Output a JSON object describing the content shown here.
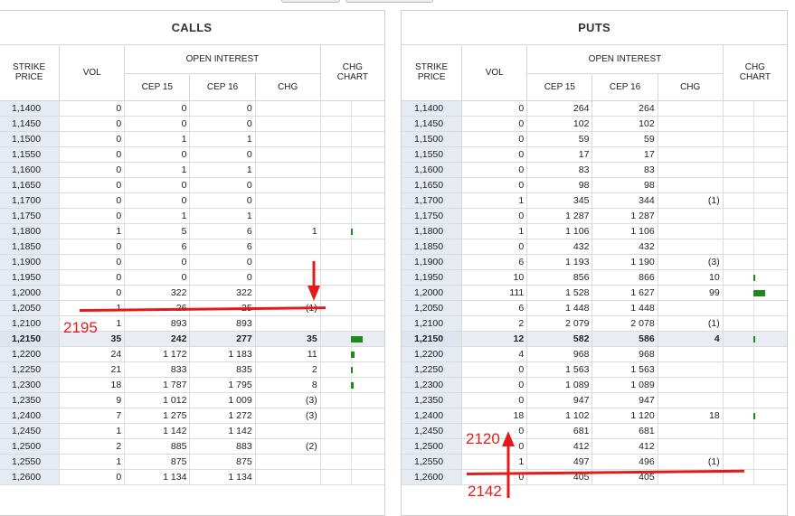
{
  "calls": {
    "title": "CALLS",
    "headers": {
      "strike": "STRIKE PRICE",
      "vol": "VOL",
      "open_interest": "OPEN INTEREST",
      "m1": "CEP 15",
      "m2": "CEP 16",
      "chg": "CHG",
      "chart": "CHG CHART"
    },
    "rows": [
      [
        "1,1400",
        "0",
        "0",
        "0",
        "",
        ""
      ],
      [
        "1,1450",
        "0",
        "0",
        "0",
        "",
        ""
      ],
      [
        "1,1500",
        "0",
        "1",
        "1",
        "",
        ""
      ],
      [
        "1,1550",
        "0",
        "0",
        "0",
        "",
        ""
      ],
      [
        "1,1600",
        "0",
        "1",
        "1",
        "",
        ""
      ],
      [
        "1,1650",
        "0",
        "0",
        "0",
        "",
        ""
      ],
      [
        "1,1700",
        "0",
        "0",
        "0",
        "",
        ""
      ],
      [
        "1,1750",
        "0",
        "1",
        "1",
        "",
        ""
      ],
      [
        "1,1800",
        "1",
        "5",
        "6",
        "1",
        "pos"
      ],
      [
        "1,1850",
        "0",
        "6",
        "6",
        "",
        ""
      ],
      [
        "1,1900",
        "0",
        "0",
        "0",
        "",
        ""
      ],
      [
        "1,1950",
        "0",
        "0",
        "0",
        "",
        ""
      ],
      [
        "1,2000",
        "0",
        "322",
        "322",
        "",
        ""
      ],
      [
        "1,2050",
        "1",
        "26",
        "25",
        "(1)",
        "neg"
      ],
      [
        "1,2100",
        "1",
        "893",
        "893",
        "",
        ""
      ],
      [
        "1,2150",
        "35",
        "242",
        "277",
        "35",
        "pos"
      ],
      [
        "1,2200",
        "24",
        "1 172",
        "1 183",
        "11",
        "pos"
      ],
      [
        "1,2250",
        "21",
        "833",
        "835",
        "2",
        "pos"
      ],
      [
        "1,2300",
        "18",
        "1 787",
        "1 795",
        "8",
        "pos"
      ],
      [
        "1,2350",
        "9",
        "1 012",
        "1 009",
        "(3)",
        "neg"
      ],
      [
        "1,2400",
        "7",
        "1 275",
        "1 272",
        "(3)",
        "neg"
      ],
      [
        "1,2450",
        "1",
        "1 142",
        "1 142",
        "",
        ""
      ],
      [
        "1,2500",
        "2",
        "885",
        "883",
        "(2)",
        "neg"
      ],
      [
        "1,2550",
        "1",
        "875",
        "875",
        "",
        ""
      ],
      [
        "1,2600",
        "0",
        "1 134",
        "1 134",
        "",
        ""
      ]
    ],
    "chart_bars": [
      {
        "row": 8,
        "value": 1
      },
      {
        "row": 15,
        "value": 35
      },
      {
        "row": 16,
        "value": 11
      },
      {
        "row": 17,
        "value": 2
      },
      {
        "row": 18,
        "value": 8
      }
    ]
  },
  "puts": {
    "title": "PUTS",
    "headers": {
      "strike": "STRIKE PRICE",
      "vol": "VOL",
      "open_interest": "OPEN INTEREST",
      "m1": "CEP 15",
      "m2": "CEP 16",
      "chg": "CHG",
      "chart": "CHG CHART"
    },
    "rows": [
      [
        "1,1400",
        "0",
        "264",
        "264",
        "",
        ""
      ],
      [
        "1,1450",
        "0",
        "102",
        "102",
        "",
        ""
      ],
      [
        "1,1500",
        "0",
        "59",
        "59",
        "",
        ""
      ],
      [
        "1,1550",
        "0",
        "17",
        "17",
        "",
        ""
      ],
      [
        "1,1600",
        "0",
        "83",
        "83",
        "",
        ""
      ],
      [
        "1,1650",
        "0",
        "98",
        "98",
        "",
        ""
      ],
      [
        "1,1700",
        "1",
        "345",
        "344",
        "(1)",
        "neg"
      ],
      [
        "1,1750",
        "0",
        "1 287",
        "1 287",
        "",
        ""
      ],
      [
        "1,1800",
        "1",
        "1 106",
        "1 106",
        "",
        ""
      ],
      [
        "1,1850",
        "0",
        "432",
        "432",
        "",
        ""
      ],
      [
        "1,1900",
        "6",
        "1 193",
        "1 190",
        "(3)",
        "neg"
      ],
      [
        "1,1950",
        "10",
        "856",
        "866",
        "10",
        "pos"
      ],
      [
        "1,2000",
        "111",
        "1 528",
        "1 627",
        "99",
        "pos"
      ],
      [
        "1,2050",
        "6",
        "1 448",
        "1 448",
        "",
        ""
      ],
      [
        "1,2100",
        "2",
        "2 079",
        "2 078",
        "(1)",
        "neg"
      ],
      [
        "1,2150",
        "12",
        "582",
        "586",
        "4",
        "pos"
      ],
      [
        "1,2200",
        "4",
        "968",
        "968",
        "",
        ""
      ],
      [
        "1,2250",
        "0",
        "1 563",
        "1 563",
        "",
        ""
      ],
      [
        "1,2300",
        "0",
        "1 089",
        "1 089",
        "",
        ""
      ],
      [
        "1,2350",
        "0",
        "947",
        "947",
        "",
        ""
      ],
      [
        "1,2400",
        "18",
        "1 102",
        "1 120",
        "18",
        "pos"
      ],
      [
        "1,2450",
        "0",
        "681",
        "681",
        "",
        ""
      ],
      [
        "1,2500",
        "0",
        "412",
        "412",
        "",
        ""
      ],
      [
        "1,2550",
        "1",
        "497",
        "496",
        "(1)",
        "neg"
      ],
      [
        "1,2600",
        "0",
        "405",
        "405",
        "",
        ""
      ]
    ],
    "chart_bars": [
      {
        "row": 11,
        "value": 10
      },
      {
        "row": 12,
        "value": 99
      },
      {
        "row": 15,
        "value": 4
      },
      {
        "row": 20,
        "value": 18
      }
    ]
  },
  "highlight_row": "1,2150",
  "annotations": {
    "calls_level": "2195",
    "puts_upper": "2120",
    "puts_lower": "2142"
  },
  "colors": {
    "annotation": "#e31b1b",
    "positive": "#2a8a2a",
    "negative": "#cc2222",
    "chart_bar": "#1e8a1e",
    "strike_bg": "#e6ebf3"
  }
}
